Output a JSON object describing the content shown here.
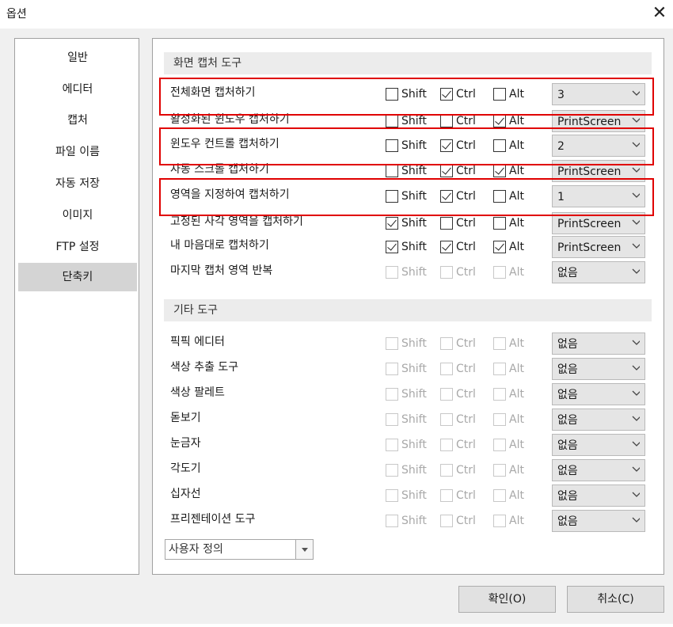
{
  "window": {
    "title": "옵션",
    "close_symbol": "✕"
  },
  "sidebar": {
    "items": [
      {
        "label": "일반"
      },
      {
        "label": "에디터"
      },
      {
        "label": "캡처"
      },
      {
        "label": "파일 이름"
      },
      {
        "label": "자동 저장"
      },
      {
        "label": "이미지"
      },
      {
        "label": "FTP 설정"
      },
      {
        "label": "단축키"
      }
    ],
    "selected": "단축키"
  },
  "modifier_labels": {
    "shift": "Shift",
    "ctrl": "Ctrl",
    "alt": "Alt"
  },
  "sections": [
    {
      "title": "화면 캡처 도구",
      "rows": [
        {
          "label": "전체화면 캡처하기",
          "shift": false,
          "ctrl": true,
          "alt": false,
          "enabled": true,
          "key": "3",
          "highlighted": true
        },
        {
          "label": "활성화된 윈도우 캡처하기",
          "shift": false,
          "ctrl": false,
          "alt": true,
          "enabled": true,
          "key": "PrintScreen",
          "highlighted": false
        },
        {
          "label": "윈도우 컨트롤 캡처하기",
          "shift": false,
          "ctrl": true,
          "alt": false,
          "enabled": true,
          "key": "2",
          "highlighted": true
        },
        {
          "label": "자동 스크롤 캡처하기",
          "shift": false,
          "ctrl": true,
          "alt": true,
          "enabled": true,
          "key": "PrintScreen",
          "highlighted": false
        },
        {
          "label": "영역을 지정하여 캡처하기",
          "shift": false,
          "ctrl": true,
          "alt": false,
          "enabled": true,
          "key": "1",
          "highlighted": true
        },
        {
          "label": "고정된 사각 영역을 캡처하기",
          "shift": true,
          "ctrl": false,
          "alt": false,
          "enabled": true,
          "key": "PrintScreen",
          "highlighted": false
        },
        {
          "label": "내 마음대로 캡처하기",
          "shift": true,
          "ctrl": true,
          "alt": true,
          "enabled": true,
          "key": "PrintScreen",
          "highlighted": false
        },
        {
          "label": "마지막 캡처 영역 반복",
          "shift": false,
          "ctrl": false,
          "alt": false,
          "enabled": false,
          "key": "없음",
          "highlighted": false
        }
      ]
    },
    {
      "title": "기타 도구",
      "rows": [
        {
          "label": "픽픽 에디터",
          "shift": false,
          "ctrl": false,
          "alt": false,
          "enabled": false,
          "key": "없음",
          "highlighted": false
        },
        {
          "label": "색상 추출 도구",
          "shift": false,
          "ctrl": false,
          "alt": false,
          "enabled": false,
          "key": "없음",
          "highlighted": false
        },
        {
          "label": "색상 팔레트",
          "shift": false,
          "ctrl": false,
          "alt": false,
          "enabled": false,
          "key": "없음",
          "highlighted": false
        },
        {
          "label": "돋보기",
          "shift": false,
          "ctrl": false,
          "alt": false,
          "enabled": false,
          "key": "없음",
          "highlighted": false
        },
        {
          "label": "눈금자",
          "shift": false,
          "ctrl": false,
          "alt": false,
          "enabled": false,
          "key": "없음",
          "highlighted": false
        },
        {
          "label": "각도기",
          "shift": false,
          "ctrl": false,
          "alt": false,
          "enabled": false,
          "key": "없음",
          "highlighted": false
        },
        {
          "label": "십자선",
          "shift": false,
          "ctrl": false,
          "alt": false,
          "enabled": false,
          "key": "없음",
          "highlighted": false
        },
        {
          "label": "프리젠테이션 도구",
          "shift": false,
          "ctrl": false,
          "alt": false,
          "enabled": false,
          "key": "없음",
          "highlighted": false
        }
      ]
    }
  ],
  "preset": {
    "value": "사용자 정의"
  },
  "buttons": {
    "ok": "확인(O)",
    "cancel": "취소(C)"
  },
  "colors": {
    "highlight": "#e00000",
    "selected_nav": "#d4d4d4",
    "section_header": "#ececec",
    "dialog_bg": "#f0f0f0"
  }
}
